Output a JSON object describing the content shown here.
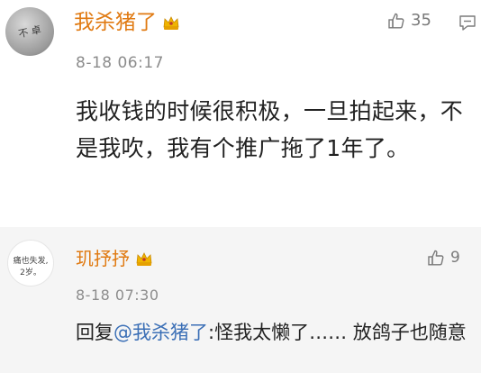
{
  "comment": {
    "username": "我杀猪了",
    "timestamp": "8-18 06:17",
    "likes": "35",
    "text": "我收钱的时候很积极，一旦拍起来，不是我吹，我有个推广拖了1年了。",
    "avatar_text": "不 卓"
  },
  "reply": {
    "username": "玑抒抒",
    "timestamp": "8-18 07:30",
    "likes": "9",
    "prefix": "回复",
    "mention": "@我杀猪了",
    "text": ":怪我太懒了…… 放鸽子也随意",
    "avatar_line1": "痛也失发,",
    "avatar_line2": "2岁。"
  },
  "colors": {
    "username": "#e07a12",
    "mention": "#3b6fb6",
    "meta": "#8c8c8c",
    "reply_bg": "#f5f5f5"
  },
  "icons": {
    "like": "thumbs-up-icon",
    "reply": "comment-icon",
    "vip": "vip-crown-icon"
  }
}
